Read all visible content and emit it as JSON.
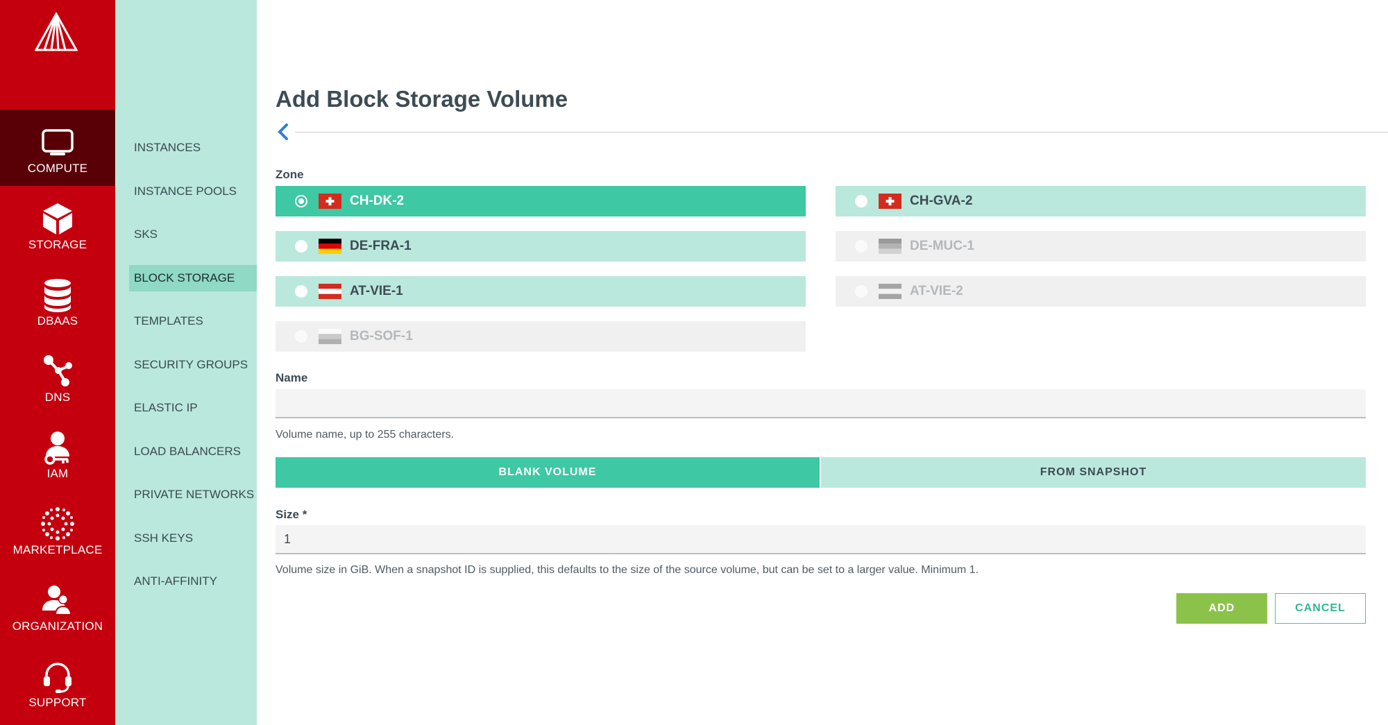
{
  "rail": {
    "items": [
      {
        "label": "COMPUTE",
        "icon": "monitor-icon"
      },
      {
        "label": "STORAGE",
        "icon": "cube-icon"
      },
      {
        "label": "DBAAS",
        "icon": "database-icon"
      },
      {
        "label": "DNS",
        "icon": "network-nodes-icon"
      },
      {
        "label": "IAM",
        "icon": "user-key-icon"
      },
      {
        "label": "MARKETPLACE",
        "icon": "dots-burst-icon"
      },
      {
        "label": "ORGANIZATION",
        "icon": "users-icon"
      },
      {
        "label": "SUPPORT",
        "icon": "headset-icon"
      }
    ],
    "active": "COMPUTE",
    "color": "#c4000e",
    "active_color": "#590007"
  },
  "submenu": {
    "items": [
      "INSTANCES",
      "INSTANCE POOLS",
      "SKS",
      "BLOCK STORAGE",
      "TEMPLATES",
      "SECURITY GROUPS",
      "ELASTIC IP",
      "LOAD BALANCERS",
      "PRIVATE NETWORKS",
      "SSH KEYS",
      "ANTI-AFFINITY"
    ],
    "active": "BLOCK STORAGE"
  },
  "page": {
    "title": "Add Block Storage Volume",
    "back_icon": "chevron-left-icon"
  },
  "zone": {
    "label": "Zone",
    "options": [
      {
        "name": "CH-DK-2",
        "state": "selected",
        "flag": "swiss-flag-icon"
      },
      {
        "name": "CH-GVA-2",
        "state": "available",
        "flag": "swiss-flag-icon"
      },
      {
        "name": "DE-FRA-1",
        "state": "available",
        "flag": "german-flag-icon"
      },
      {
        "name": "DE-MUC-1",
        "state": "disabled",
        "flag": "german-flag-icon"
      },
      {
        "name": "AT-VIE-1",
        "state": "available",
        "flag": "austrian-flag-icon"
      },
      {
        "name": "AT-VIE-2",
        "state": "disabled",
        "flag": "austrian-flag-icon"
      },
      {
        "name": "BG-SOF-1",
        "state": "disabled",
        "flag": "bulgarian-flag-icon"
      }
    ]
  },
  "name_field": {
    "label": "Name",
    "value": "",
    "help": "Volume name, up to 255 characters."
  },
  "source": {
    "blank_label": "BLANK VOLUME",
    "snapshot_label": "FROM SNAPSHOT",
    "selected": "BLANK VOLUME"
  },
  "size_field": {
    "label": "Size *",
    "value": "1",
    "help": "Volume size in GiB. When a snapshot ID is supplied, this defaults to the size of the source volume, but can be set to a larger value. Minimum 1."
  },
  "actions": {
    "add_label": "ADD",
    "cancel_label": "CANCEL"
  },
  "colors": {
    "accent": "#3ec8a4",
    "accent_light": "#bae8dc",
    "add_button": "#8bc34a",
    "disabled": "#f0f0f0"
  }
}
